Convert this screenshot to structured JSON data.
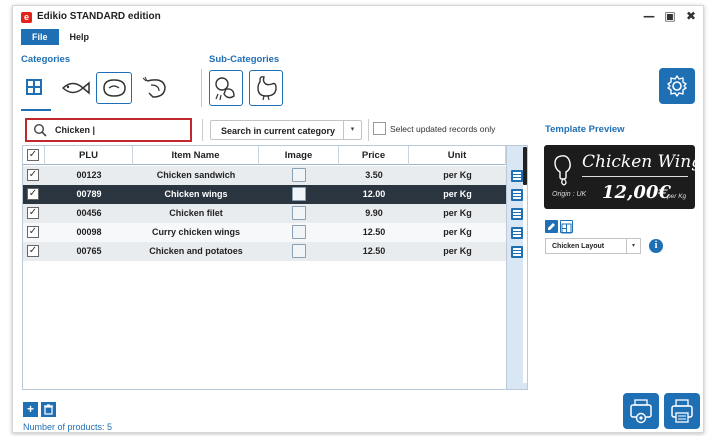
{
  "app": {
    "title": "Edikio STANDARD edition",
    "logo_letter": "e"
  },
  "window_controls": {
    "minimize": "—",
    "maximize": "▣",
    "close": "✖"
  },
  "menu": [
    {
      "label": "File"
    },
    {
      "label": "Help"
    }
  ],
  "categories": {
    "label": "Categories",
    "items": [
      {
        "icon": "grid-icon"
      },
      {
        "icon": "fish-icon"
      },
      {
        "icon": "meat-icon"
      },
      {
        "icon": "shrimp-icon"
      }
    ],
    "selected": "meat-icon"
  },
  "subcategories": {
    "label": "Sub-Categories",
    "items": [
      {
        "icon": "chicken-parts-icon"
      },
      {
        "icon": "rooster-icon"
      }
    ]
  },
  "search": {
    "value": "Chicken |",
    "scope": "Search in current category",
    "updated_only_label": "Select updated records only",
    "updated_only_checked": false
  },
  "table": {
    "columns": [
      "PLU",
      "Item Name",
      "Image",
      "Price",
      "Unit"
    ],
    "header_checked": true,
    "rows": [
      {
        "checked": true,
        "plu": "00123",
        "name": "Chicken sandwich",
        "price": "3.50",
        "unit": "per Kg",
        "selected": false
      },
      {
        "checked": true,
        "plu": "00789",
        "name": "Chicken wings",
        "price": "12.00",
        "unit": "per Kg",
        "selected": true
      },
      {
        "checked": true,
        "plu": "00456",
        "name": "Chicken filet",
        "price": "9.90",
        "unit": "per Kg",
        "selected": false
      },
      {
        "checked": true,
        "plu": "00098",
        "name": "Curry chicken wings",
        "price": "12.50",
        "unit": "per Kg",
        "selected": false
      },
      {
        "checked": true,
        "plu": "00765",
        "name": "Chicken and potatoes",
        "price": "12.50",
        "unit": "per Kg",
        "selected": false
      }
    ]
  },
  "preview": {
    "label": "Template Preview",
    "tag_name": "Chicken Wings",
    "tag_origin": "Origin : UK",
    "tag_price": "12,00€",
    "tag_unit": "per Kg",
    "layout": "Chicken Layout",
    "info": "i"
  },
  "footer": {
    "add": "+",
    "delete": "🗑",
    "product_count": "Number of products: 5"
  },
  "colors": {
    "accent": "#1f6fb5",
    "search_border": "#c0282d",
    "selected_row": "#2b3540",
    "tag_bg": "#1c1c1c"
  }
}
